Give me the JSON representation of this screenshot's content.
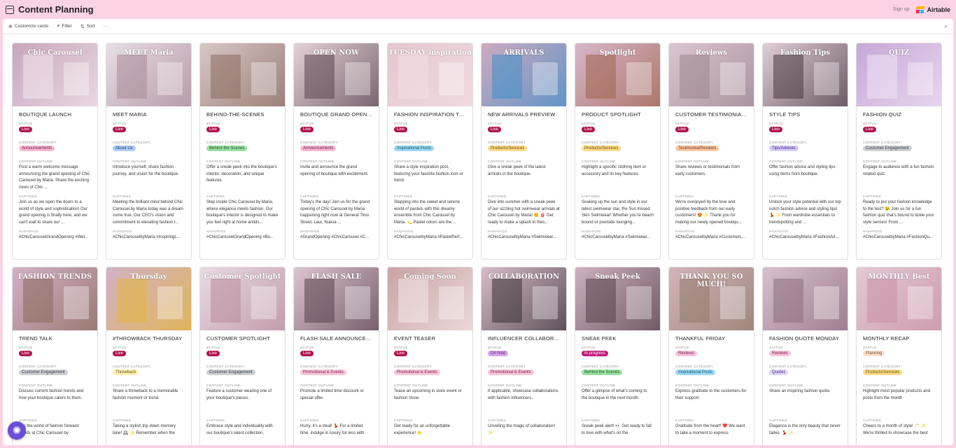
{
  "app": {
    "title": "Content Planning",
    "signup": "Sign up",
    "brand": "Airtable"
  },
  "toolbar": {
    "customize": "Customize cards",
    "filter": "Filter",
    "sort": "Sort",
    "more": "···"
  },
  "labels": {
    "status": "STATUS",
    "category": "CONTENT CATEGORY",
    "outline": "CONTENT OUTLINE",
    "captions": "CAPTIONS",
    "hashtags": "HASHTAGS"
  },
  "colors": {
    "page_bg": "#fbd3e4",
    "live": "#b0144d",
    "accent": "#6a4ed6"
  },
  "cards": [
    {
      "title": "BOUTIQUE LAUNCH",
      "status": "Live",
      "category": "Announcements",
      "outline": "Post a warm welcome message announcing the grand opening of Chic Carousel by Maria. Share the exciting news of Chic ...",
      "caption": "Join us as we open the doors to a world of style and sophistication! Our grand opening is finally here, and we can't wait to share our ...",
      "hashtags": "#ChicCarouselGrandOpening #Wel...",
      "img": {
        "bg": "#c9a6bd",
        "text": "Chic Carousel",
        "accent": "#f2e6ee"
      }
    },
    {
      "title": "MEET MARIA",
      "status": "Live",
      "category": "About Us",
      "outline": "Introduce yourself, share fashion journey, and vision for the boutique.",
      "caption": "Meeting the brilliant mind behind Chic Carousel by Maria today was a dream come true. Our CEO's vision and commitment to elevating fashion i...",
      "hashtags": "#ChicCarouselbyMaria #InspiringL...",
      "img": {
        "bg": "#e8dde6",
        "text": "MEET Maria",
        "accent": "#a98899"
      }
    },
    {
      "title": "BEHIND-THE-SCENES",
      "status": "Live",
      "category": "Behind the Scenes",
      "outline": "Offer a sneak peek into the boutique's interior, decoration, and unique features.",
      "caption": "Step inside Chic Carousel by Maria, where elegance meets fashion. Our boutique's interior is designed to make you feel right at home amids...",
      "hashtags": "#ChicCarouselGrandOpening #Bo...",
      "img": {
        "bg": "#d9c7c4",
        "text": "",
        "accent": "#8a6c62"
      }
    },
    {
      "title": "BOUTIQUE GRAND OPENI...",
      "status": "Live",
      "category": "Announcements",
      "outline": "Invite and announce the grand opening of boutique with excitement.",
      "caption": "Today's the day! Join us for the grand opening of Chic Carousel by Maria happening right now at General Tinio Street, Laur, Nueva ...",
      "hashtags": "#GrandOpening #ChicCarousel #C...",
      "img": {
        "bg": "#e3d2d6",
        "text": "OPEN NOW",
        "accent": "#5b4552"
      }
    },
    {
      "title": "FASHION INSPIRATION TU...",
      "status": "Live",
      "category": "Inspirational Posts",
      "outline": "Share a style inspiration post, featuring your favorite fashion icon or trend.",
      "caption": "Stepping into the sweet and serene world of pastels with this dreamy ensemble from Chic Carousel by Maria. 💫 Pastel colors are the ...",
      "hashtags": "#ChicCarouselbyMaria #PastelPerf...",
      "img": {
        "bg": "#e4c7cf",
        "text": "TUESDAY inspiration",
        "accent": "#f5dfe4"
      }
    },
    {
      "title": "NEW ARRIVALS PREVIEW",
      "status": "Live",
      "category": "Products/Services",
      "outline": "Give a sneak peek of the latest arrivals in the boutique.",
      "caption": "Dive into summer with a sneak peek of our sizzling hot swimwear arrivals at Chic Carousel by Maria! 😊 👙 Get ready to make a splash in thes...",
      "hashtags": "#ChicCarouselbyMaria #Swimwear...",
      "img": {
        "bg": "#cfa9c0",
        "text": "ARRIVALS",
        "accent": "#3f8fc9"
      }
    },
    {
      "title": "PRODUCT SPOTLIGHT",
      "status": "Live",
      "category": "Products/Services",
      "outline": "Highlight a specific clothing item or accessory and its key features.",
      "caption": "Soaking up the sun and style in our latest swimwear star, the Sun Kissed Skin Swimwear! Whether you're beach bound or poolside lounging...",
      "hashtags": "#ChicCarouselbyMaria #Swimwear...",
      "img": {
        "bg": "#d8b7c9",
        "text": "Spotlight",
        "accent": "#a0644f"
      }
    },
    {
      "title": "CUSTOMER TESTIMONIALS",
      "status": "Live",
      "category": "Testimonial/Reviews",
      "outline": "Share reviews or testimonials from early customers.",
      "caption": "We're overjoyed by the love and positive feedback from our early customers! 😍 ✨ Thank you for making our newly opened boutiqu...",
      "hashtags": "#ChicCarouselbyMaria #CustomerL...",
      "img": {
        "bg": "#dcc5d2",
        "text": "Reviews",
        "accent": "#9c8592"
      }
    },
    {
      "title": "STYLE TIPS",
      "status": "Live",
      "category": "Tips/Advices",
      "outline": "Offer fashion advice and styling tips using items from boutique.",
      "caption": "Unlock your style potential with our top notch fashion advice and styling tips! 💃 ✨ From wardrobe essentials to trendspotting and ...",
      "hashtags": "#ChicCarouselbyMaria #FashionAd...",
      "img": {
        "bg": "#e1cdd8",
        "text": "Fashion Tips",
        "accent": "#4a3a44"
      }
    },
    {
      "title": "FASHION QUIZ",
      "status": "Live",
      "category": "Customer Engagement",
      "outline": "Engage to audience with a fun fashion related quiz.",
      "caption": "Ready to put your fashion knowledge to the test? 😉 Join us for a fun fashion quiz that's bound to tickle your style senses! From ...",
      "hashtags": "#ChicCarouselbyMaria #FashionQu...",
      "img": {
        "bg": "#c6a7d8",
        "text": "QUIZ",
        "accent": "#f0e4f4"
      }
    },
    {
      "title": "TREND TALK",
      "status": "Live",
      "category": "Customer Engagement",
      "outline": "Discuss current fashion trends and how your boutique caters to them.",
      "caption": "into the world of fashion forward trends at Chic Carousel by",
      "hashtags": "",
      "img": {
        "bg": "#d4b0c8",
        "text": "FASHION TRENDS",
        "accent": "#8b6a5a"
      }
    },
    {
      "title": "#THROWBACK THURSDAY",
      "status": "Live",
      "category": "Throwback",
      "outline": "Share a throwback to a memorable fashion moment or trend.",
      "caption": "Taking a stylish trip down memory lane! 🕰 ✨ Remember when the",
      "hashtags": "",
      "img": {
        "bg": "#d2b2c6",
        "text": "Thursday",
        "accent": "#e3b53c"
      }
    },
    {
      "title": "CUSTOMER SPOTLIGHT",
      "status": "Live",
      "category": "Customer Engagement",
      "outline": "Feature a customer wearing one of your boutique's pieces.",
      "caption": "Embrace style and individuality with our boutique's latest collection,",
      "hashtags": "",
      "img": {
        "bg": "#e8dbe2",
        "text": "Customer Spotlight",
        "accent": "#b88a9e"
      }
    },
    {
      "title": "FLASH SALE ANNOUNCEM...",
      "status": "Live",
      "category": "Promotional & Events",
      "outline": "Promote a limited time discount or special offer.",
      "caption": "Hurry, it's a steal! 💃 For a limited time, indulge in luxury for less with",
      "hashtags": "",
      "img": {
        "bg": "#dcc4d0",
        "text": "FLASH SALE",
        "accent": "#5a4250"
      }
    },
    {
      "title": "EVENT TEASER",
      "status": "Live",
      "category": "Promotional & Events",
      "outline": "Tease an upcoming in store event or fashion show.",
      "caption": "Get ready for an unforgettable experience! 🌟",
      "hashtags": "",
      "img": {
        "bg": "#c9a3a4",
        "text": "Coming Soon",
        "accent": "#f4e8e6"
      }
    },
    {
      "title": "INFLUENCER COLLABORAT...",
      "status": "On hold",
      "category": "Promotional & Events",
      "outline": "If applicable, showcase collaborations with fashion influencers.",
      "caption": "Unveiling the magic of collaboration! ✨",
      "hashtags": "",
      "img": {
        "bg": "#d7bccb",
        "text": "COLLABORATION",
        "accent": "#3a3138"
      }
    },
    {
      "title": "SNEAK PEEK",
      "status": "In progress",
      "category": "Behind the Scenes",
      "outline": "Offer a glimpse of what's coming to the boutique in the next month.",
      "caption": "Sneak peek alert! 👀 Get ready to fall in love with what's on the",
      "hashtags": "",
      "img": {
        "bg": "#cdb1c1",
        "text": "Sneak Peek",
        "accent": "#5a3f4d"
      }
    },
    {
      "title": "THANKFUL FRIDAY",
      "status": "Reviews",
      "category": "Inspirational Posts",
      "outline": "Express gratitude to the customers for their support.",
      "caption": "Gratitude from the heart! ❤️ We want to take a moment to express",
      "hashtags": "",
      "img": {
        "bg": "#d4b4b8",
        "text": "THANK YOU SO MUCH!",
        "accent": "#8f7a6b"
      }
    },
    {
      "title": "FASHION QUOTE MONDAY",
      "status": "Reviews",
      "category": "Quotes",
      "outline": "Share an inspiring fashion quote.",
      "caption": "Elegance is the only beauty that never fades. 💃 ✨",
      "hashtags": "",
      "img": {
        "bg": "#d9bfd0",
        "text": "",
        "accent": "#8c6d7e"
      }
    },
    {
      "title": "MONTHLY RECAP",
      "status": "Planning",
      "category": "Products/Services",
      "outline": "Highlight most popular products and posts from the month",
      "caption": "Cheers to a month of style! 🥂 ✨ We're thrilled to showcase the best",
      "hashtags": "",
      "img": {
        "bg": "#e3c9d4",
        "text": "MONTHLY Best",
        "accent": "#c88fa4"
      }
    }
  ]
}
